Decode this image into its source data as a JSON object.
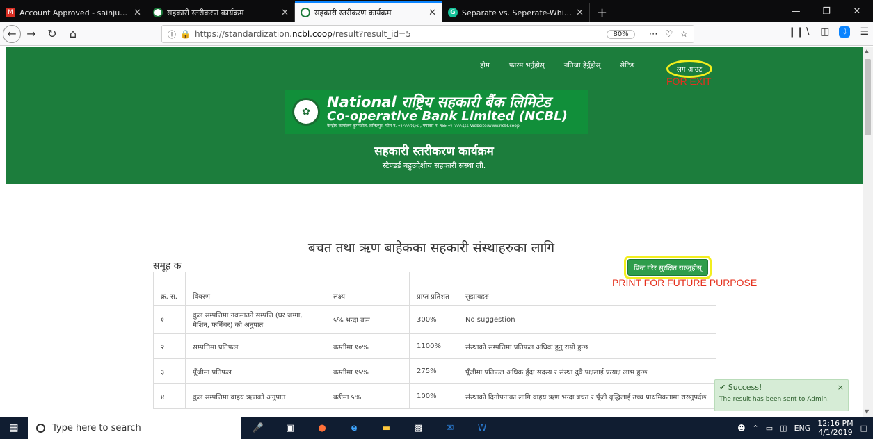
{
  "browser": {
    "tabs": [
      {
        "title": "Account Approved - sainjuanuj",
        "favicon": "gmail-icon",
        "close": "✕"
      },
      {
        "title": "सहकारी स्तरीकरण कार्यक्रम",
        "favicon": "ncbl-icon",
        "close": "✕"
      },
      {
        "title": "सहकारी स्तरीकरण कार्यक्रम",
        "favicon": "ncbl-icon",
        "close": "✕"
      },
      {
        "title": "Separate vs. Seperate-Which Sh",
        "favicon": "grammarly-icon",
        "close": "✕"
      }
    ],
    "new_tab": "+",
    "url_prefix": "https://standardization.",
    "url_host": "ncbl.coop",
    "url_path": "/result?result_id=5",
    "zoom": "80%"
  },
  "page": {
    "menu": [
      "होम",
      "फारम भर्नुहोस्",
      "नतिजा हेर्नुहोस्",
      "सेटिङ"
    ],
    "logout": "लग आउट",
    "exit_annotation": "FOR EXIT",
    "logo": {
      "line1_en": "National",
      "line1_np": "राष्ट्रिय सहकारी बैंक लिमिटेड",
      "line2": "Co-operative Bank Limited (NCBL)",
      "line3": "केन्द्रीय कार्यालय कुपण्डोल, ललितपुर, फोन नं. ०१ ५५५२६०८ , फ्याक्स नं. ९७७-०१ ५५५५६८८ Website:www.ncbl.coop"
    },
    "hero_title": "सहकारी स्तरीकरण कार्यक्रम",
    "hero_subtitle": "स्टैण्डर्ड बहुउदेशीय सहकारी संस्था ली.",
    "section_title": "बचत तथा ऋण बाहेकका सहकारी संस्थाहरुका लागि",
    "group_label": "समूह क",
    "print_button": "प्रिन्ट गरेर सुरक्षित राख्नुहोस्",
    "print_annotation": "PRINT FOR FUTURE PURPOSE",
    "table": {
      "headers": [
        "क्र. स.",
        "विवरण",
        "लक्ष्य",
        "प्राप्त प्रतिशत",
        "सुझावहरु"
      ],
      "rows": [
        [
          "१",
          "कुल सम्पत्तिमा नकमाउने सम्पत्ति (घर जग्गा, मेशिन, फर्निचर) को अनुपात",
          "५% भन्दा कम",
          "300%",
          "No suggestion"
        ],
        [
          "२",
          "सम्पत्तिमा प्रतिफल",
          "कम्तीमा १०%",
          "1100%",
          "संस्थाको सम्पत्तिमा प्रतिफल अधिक हुनु राम्रो हुन्छ"
        ],
        [
          "३",
          "पूँजीमा प्रतिफल",
          "कम्तीमा १५%",
          "275%",
          "पूँजीमा प्रतिफल अधिक हुँदा सदस्य र संस्था दुवै पक्षलाई प्रत्यक्ष लाभ हुन्छ"
        ],
        [
          "४",
          "कुल सम्पत्तिमा वाहय ऋणको अनुपात",
          "बढीमा ५%",
          "100%",
          "संस्थाको दिगोपनाका लागि वाहय ऋण भन्दा बचत र पूँजी बृद्धिलाई उच्च प्राथमिकतामा राख्नुपर्दछ"
        ]
      ]
    },
    "toast": {
      "title": "Success!",
      "message": "The result has been sent to Admin.",
      "close": "×"
    }
  },
  "taskbar": {
    "search_placeholder": "Type here to search",
    "language": "ENG",
    "time": "12:16 PM",
    "date": "4/1/2019"
  },
  "colors": {
    "brand_green": "#1c7d3c",
    "annotation_red": "#e5301d",
    "highlight_yellow": "#f2ee1e"
  }
}
